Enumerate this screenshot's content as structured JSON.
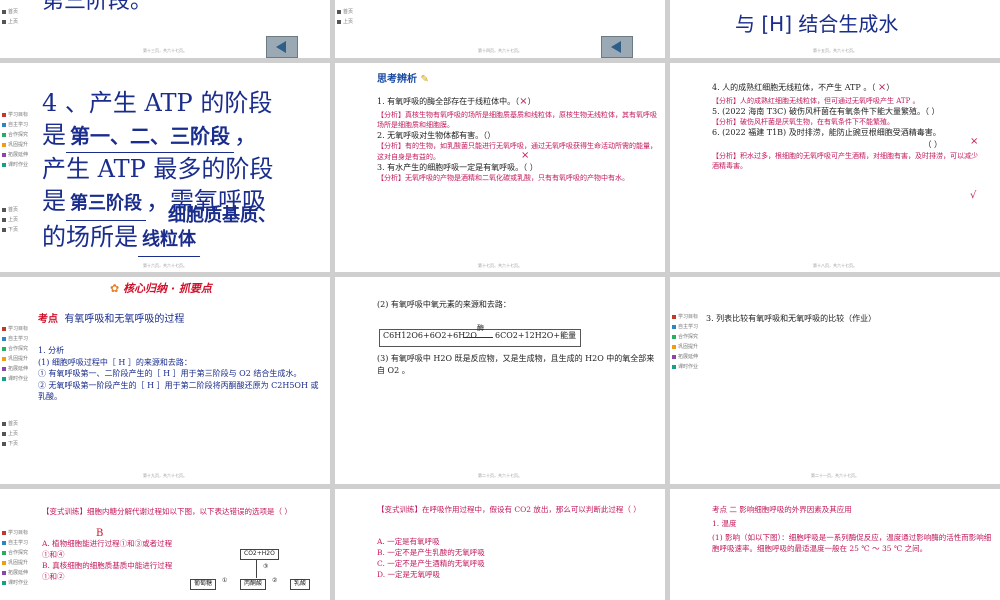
{
  "nav_items": [
    "学习目标",
    "自主学习",
    "合作探究",
    "巩固提升",
    "拓展延伸",
    "课时作业"
  ],
  "nav_colors": [
    "#c0392b",
    "#2e86c1",
    "#27ae60",
    "#f39c12",
    "#8e44ad",
    "#16a085"
  ],
  "nav_mini": [
    "首页",
    "上页",
    "下页"
  ],
  "s0": {
    "text": "第三阶段。",
    "page": "第十三页，共六十七页。"
  },
  "s1": {
    "page": "第十四页，共六十七页。"
  },
  "s2": {
    "text": "与 [H] 结合生成水",
    "page": "第十五页，共六十七页。"
  },
  "s3": {
    "l1": "4 、产生 ATP 的阶段",
    "l2a": "是",
    "l2b": "第一、二、三阶段",
    "l2c": "，",
    "l3": "产生 ATP 最多的阶段",
    "l4a": "是",
    "l4b": "第三阶段",
    "l4c": "，需氧呼吸",
    "l4d": "细胞质基质、",
    "l5a": "的场所是",
    "l5b": "线粒体",
    "page": "第十六页，共六十七页。"
  },
  "s4": {
    "header": "思考辨析",
    "q1": "1. 有氧呼吸的酶全部存在于线粒体中。（",
    "q1x": "×",
    "q1end": "）",
    "a1": "【分析】真核生物有氧呼吸的场所是细胞质基质和线粒体，原核生物无线粒体，其有氧呼吸场所是细胞质和细胞膜。",
    "q2": "2. 无氧呼吸对生物体都有害。（",
    "q2x": "×",
    "q2end": "）",
    "a2": "【分析】有的生物，如乳酸菌只能进行无氧呼吸，通过无氧呼吸获得生命活动所需的能量，这对自身是有益的。",
    "q3": "3. 有水产生的细胞呼吸一定是有氧呼吸。（    ）",
    "a3": "【分析】无氧呼吸的产物是酒精和二氧化碳或乳酸，只有有氧呼吸的产物中有水。",
    "page": "第十七页，共六十七页。"
  },
  "s5": {
    "q4": "4. 人的成熟红细胞无线粒体，不产生 ATP 。（",
    "q4x": "×",
    "q4end": "）",
    "a4": "【分析】人的成熟红细胞无线粒体，但可通过无氧呼吸产生 ATP 。",
    "q5": "5. (2022 海南 T3C) 破伤风杆菌在有氧条件下能大量繁殖。（    ）",
    "q5x": "×",
    "a5": "【分析】破伤风杆菌是厌氧生物，在有氧条件下不能繁殖。",
    "q6": "6. (2022 福建 T1B) 及时排涝，能防止豌豆根细胞受酒精毒害。",
    "q6b": "（    ）",
    "q6x": "√",
    "a6": "【分析】积水过多，根细胞的无氧呼吸可产生酒精，对细胞有害，及时排涝，可以减少酒精毒害。",
    "page": "第十八页，共六十七页。"
  },
  "s6": {
    "banner": "核心归纳 · 抓要点",
    "title_a": "考点",
    "title_b": "有氧呼吸和无氧呼吸的过程",
    "p1": "1. 分析",
    "p2": "(1) 细胞呼吸过程中［ H ］的来源和去路：",
    "p3": "① 有氧呼吸第一、二阶段产生的［ H ］用于第三阶段与 O2 结合生成水。",
    "p4": "② 无氧呼吸第一阶段产生的［ H ］用于第二阶段将丙酮酸还原为 C2H5OH 或乳酸。",
    "page": "第十九页，共六十七页。"
  },
  "s7": {
    "p1": "(2) 有氧呼吸中氧元素的来源和去路：",
    "eq_left": "C6H12O6+6O2+6H2O",
    "eq_enzyme": "酶",
    "eq_right": "6CO2+12H2O+能量",
    "p2": "(3) 有氧呼吸中 H2O 既是反应物，又是生成物，且生成的 H2O 中的氧全部来自 O2 。",
    "page": "第二十页，共六十七页。"
  },
  "s8": {
    "p1": "3. 列表比较有氧呼吸和无氧呼吸的比较（作业）",
    "page": "第二十一页，共六十七页。"
  },
  "s9": {
    "q": "【变式训练】细胞内糖分解代谢过程如以下图，以下表达错误的选项是（    ）",
    "ans": "B",
    "oa": "A. 植物细胞能进行过程①和③或者过程①和④",
    "ob": "B. 真核细胞的细胞质基质中能进行过程①和②",
    "d_top": "CO2+H2O",
    "d_left": "葡萄糖",
    "d_mid": "丙酮酸",
    "d_right": "乳酸",
    "d_n1": "①",
    "d_n2": "②",
    "d_n3": "③"
  },
  "s10": {
    "q": "【变式训练】在呼吸作用过程中，假设有 CO2 放出，那么可以判断此过程（    ）",
    "oa": "A. 一定是有氧呼吸",
    "ob": "B. 一定不是产生乳酸的无氧呼吸",
    "oc": "C. 一定不是产生酒精的无氧呼吸",
    "od": "D. 一定是无氧呼吸"
  },
  "s11": {
    "title": "考点 二 影响细胞呼吸的外界因素及其应用",
    "p1": "1. 温度",
    "p2": "(1) 影响（如以下图）：细胞呼吸是一系列酶促反应，温度通过影响酶的活性而影响细胞呼吸速率。细胞呼吸的最适温度一般在 25 ℃ ～ 35 ℃ 之间。"
  }
}
